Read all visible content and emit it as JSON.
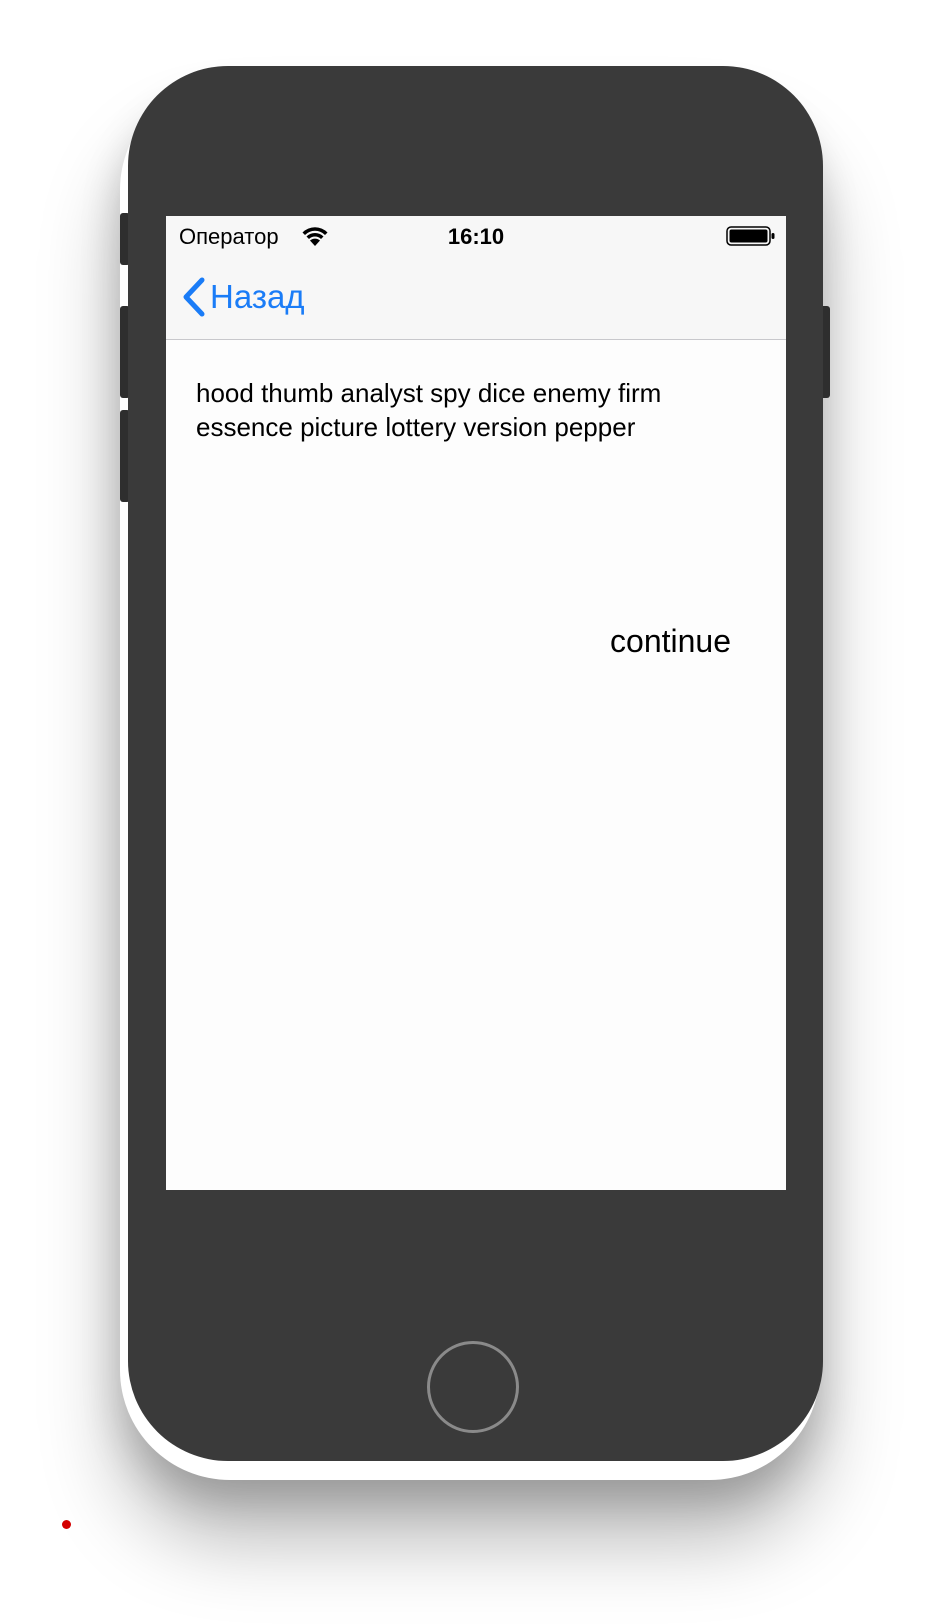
{
  "status_bar": {
    "carrier": "Оператор",
    "time": "16:10",
    "wifi_icon": "wifi-icon",
    "battery_icon": "battery-full-icon"
  },
  "nav_bar": {
    "back_label": "Назад",
    "back_icon": "chevron-left-icon"
  },
  "content": {
    "mnemonic_text": "hood thumb analyst spy dice enemy firm essence picture lottery version pepper",
    "continue_label": "continue"
  },
  "colors": {
    "accent": "#1a7cf7",
    "device_body": "#3a3a3a",
    "screen_bg": "#fdfdfd",
    "bar_bg": "#f7f7f7"
  }
}
